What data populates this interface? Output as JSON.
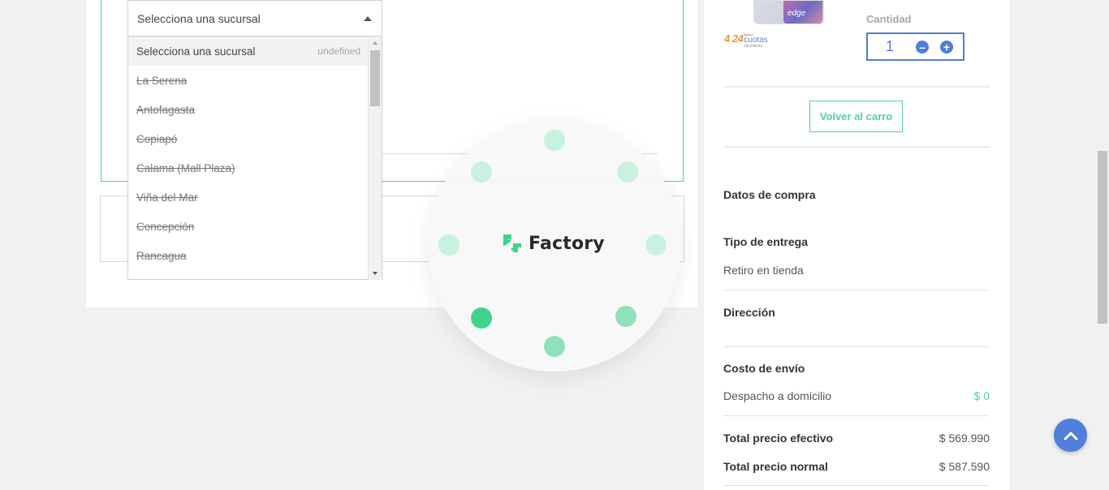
{
  "branch_select": {
    "selected": "Selecciona una sucursal",
    "options": [
      {
        "label": "Selecciona una sucursal",
        "meta": "undefined"
      },
      {
        "label": "La Serena"
      },
      {
        "label": "Antofagasta"
      },
      {
        "label": "Copiapó"
      },
      {
        "label": "Calama (Mall Plaza)"
      },
      {
        "label": "Viña del Mar"
      },
      {
        "label": "Concepción"
      },
      {
        "label": "Rancagua"
      }
    ]
  },
  "loader": {
    "brand": "Factory",
    "accent_color": "#3fd48e"
  },
  "product": {
    "screen_label": "edge",
    "cuotas_number": "4 24",
    "cuotas_top": "Banco",
    "cuotas_main": "cuotas",
    "cuotas_sub": "sin interés"
  },
  "quantity": {
    "label": "Cantidad",
    "value": "1"
  },
  "cart": {
    "back_button": "Volver al carro"
  },
  "summary": {
    "datos_title": "Datos de compra",
    "tipo_title": "Tipo de entrega",
    "tipo_value": "Retiro en tienda",
    "direccion_title": "Dirección",
    "costo_title": "Costo de envío",
    "despacho_label": "Despacho a domicilio",
    "despacho_value": "$ 0",
    "total_efectivo_label": "Total precio efectivo",
    "total_efectivo_value": "$ 569.990",
    "total_normal_label": "Total precio normal",
    "total_normal_value": "$ 587.590"
  },
  "colors": {
    "teal": "#4fd1a3",
    "blue": "#4f7edb"
  }
}
